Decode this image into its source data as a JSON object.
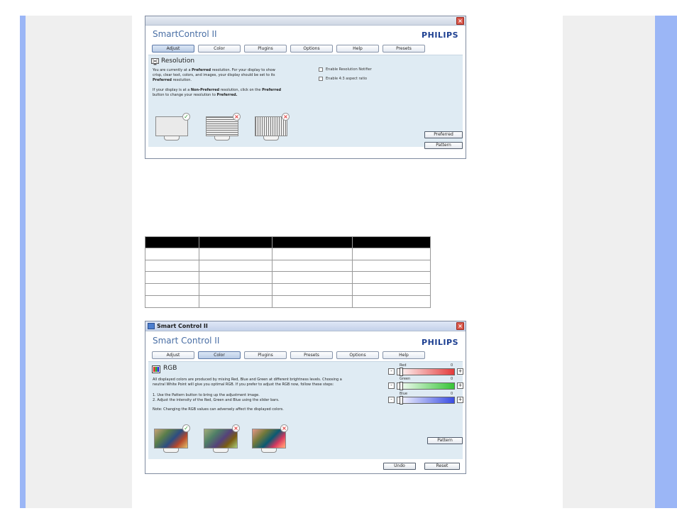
{
  "window1": {
    "app_title": "SmartControl II",
    "brand": "PHILIPS",
    "tabs": [
      {
        "label": "Adjust"
      },
      {
        "label": "Color"
      },
      {
        "label": "Plugins"
      },
      {
        "label": "Options"
      },
      {
        "label": "Help"
      },
      {
        "label": "Presets"
      }
    ],
    "section_title": "Resolution",
    "para1_a": "You are currently at a ",
    "para1_b": "Preferred",
    "para1_c": " resolution. For your display to show crisp, clear text, colors, and images, your display should be set to its ",
    "para1_d": "Preferred",
    "para1_e": " resolution.",
    "para2_a": "If your display is at a ",
    "para2_b": "Non-Preferred",
    "para2_c": " resolution, click on the ",
    "para2_d": "Preferred",
    "para2_e": " button to change your resolution to ",
    "para2_f": "Preferred.",
    "check1": "Enable Resolution Notifier",
    "check2": "Enable 4:3 aspect ratio",
    "btn_preferred": "Preferred",
    "btn_pattern": "Pattern"
  },
  "window2": {
    "title": "Smart Control II",
    "app_title": "Smart Control II",
    "brand": "PHILIPS",
    "tabs": [
      {
        "label": "Adjust"
      },
      {
        "label": "Color"
      },
      {
        "label": "Plugins"
      },
      {
        "label": "Presets"
      },
      {
        "label": "Options"
      },
      {
        "label": "Help"
      }
    ],
    "section_title": "RGB",
    "para1": "All displayed colors are produced by mixing Red, Blue and Green at different brightness levels. Choosing a neutral White Point will give you optimal RGB. If you prefer to adjust the RGB now, follow these steps:",
    "step1": "1. Use the Pattern button to bring up the adjustment image.",
    "step2": "2. Adjust the intensity of the Red, Green and Blue using the slider bars.",
    "note": "Note: Changing the RGB values can adversely affect the displayed colors.",
    "sliders": [
      {
        "label": "Red",
        "value": "0",
        "color": "#e33a3a"
      },
      {
        "label": "Green",
        "value": "0",
        "color": "#36c436"
      },
      {
        "label": "Blue",
        "value": "0",
        "color": "#3a4de3"
      }
    ],
    "minus": "-",
    "plus": "+",
    "btn_pattern": "Pattern",
    "btn_undo": "Undo",
    "btn_reset": "Reset"
  },
  "icons": {
    "ok": "✓",
    "bad": "×",
    "close": "×"
  }
}
